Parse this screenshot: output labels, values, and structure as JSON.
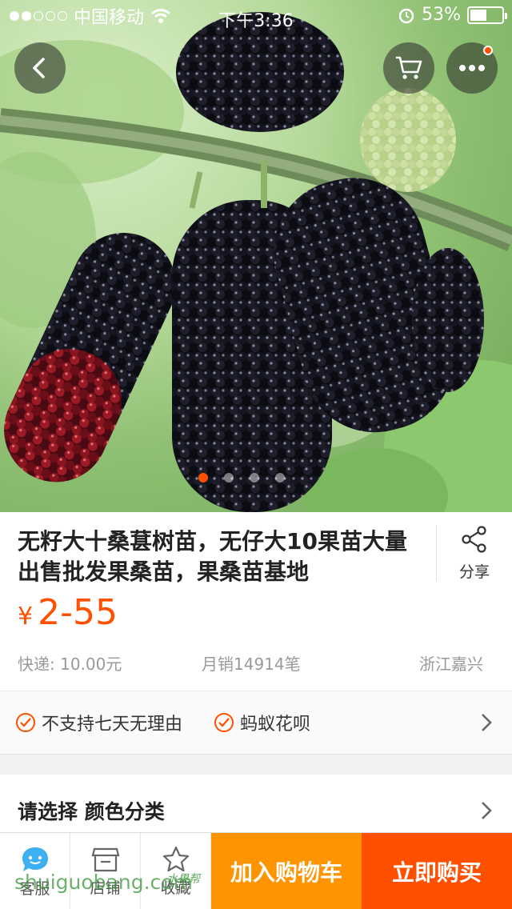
{
  "status_bar": {
    "carrier": "中国移动",
    "time": "下午3:36",
    "battery_percent": "53%",
    "battery_level": 0.53
  },
  "header": {
    "back_icon": "chevron-left-icon",
    "cart_icon": "cart-icon",
    "more_icon": "more-icon",
    "more_has_badge": true
  },
  "gallery": {
    "image_subject": "mulberries",
    "page_count": 4,
    "active_page": 1
  },
  "product": {
    "title": "无籽大十桑葚树苗，无仔大10果苗大量出售批发果桑苗，果桑苗基地",
    "share_label": "分享",
    "currency": "¥",
    "price": "2-55",
    "shipping": "快递: 10.00元",
    "monthly_sales": "月销14914笔",
    "location": "浙江嘉兴"
  },
  "services": {
    "items": [
      "不支持七天无理由",
      "蚂蚁花呗"
    ]
  },
  "select": {
    "label": "请选择 颜色分类"
  },
  "bottom_bar": {
    "service_label": "客服",
    "shop_label": "店铺",
    "favorite_label": "收藏",
    "add_to_cart": "加入购物车",
    "buy_now": "立即购买"
  },
  "watermark": {
    "text": "shuiguobang.com",
    "cn_text": "水果帮"
  },
  "colors": {
    "accent_orange": "#ff5000",
    "cart_orange": "#ff9402"
  }
}
